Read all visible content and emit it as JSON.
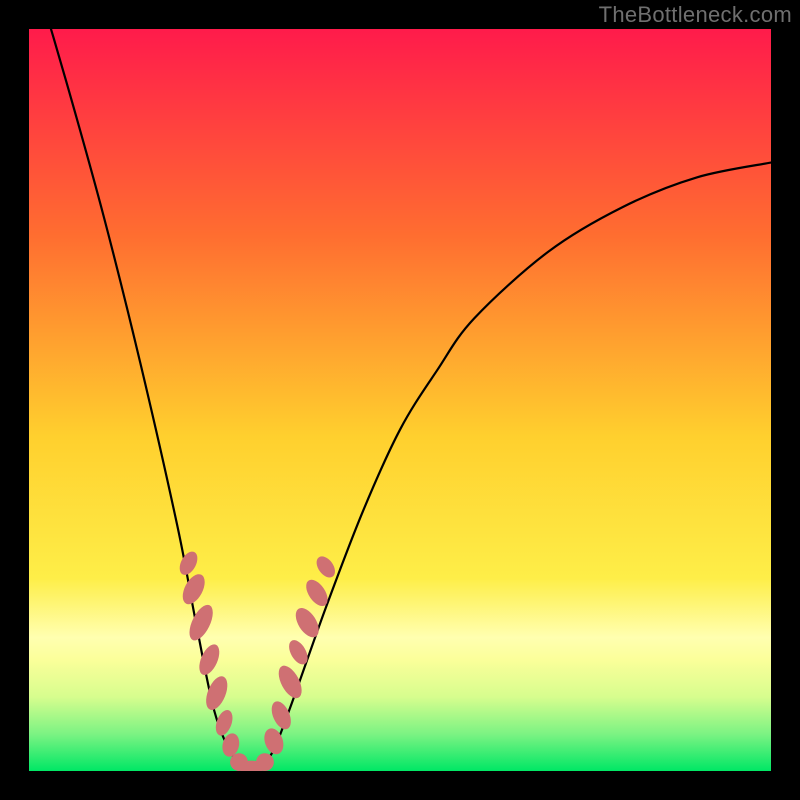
{
  "watermark": "TheBottleneck.com",
  "chart_data": {
    "type": "line",
    "title": "",
    "xlabel": "",
    "ylabel": "",
    "series": [
      {
        "name": "bottleneck-curve",
        "x": [
          0.0,
          0.05,
          0.1,
          0.15,
          0.2,
          0.225,
          0.25,
          0.275,
          0.3,
          0.325,
          0.35,
          0.4,
          0.45,
          0.5,
          0.55,
          0.6,
          0.7,
          0.8,
          0.9,
          1.0
        ],
        "values": [
          1.1,
          0.93,
          0.75,
          0.55,
          0.33,
          0.2,
          0.08,
          0.02,
          0.0,
          0.02,
          0.08,
          0.22,
          0.35,
          0.46,
          0.54,
          0.61,
          0.7,
          0.76,
          0.8,
          0.82
        ]
      }
    ],
    "xlim": [
      0,
      1
    ],
    "ylim": [
      0,
      1
    ],
    "colors": {
      "gradient_top": "#ff1b4b",
      "gradient_mid_hi": "#ff8a28",
      "gradient_mid": "#ffde2e",
      "gradient_pale": "#ffffb0",
      "gradient_bottom": "#00e765",
      "curve_stroke": "#000000",
      "blob_fill": "#cf7073"
    },
    "blobs_left": [
      {
        "cx": 0.215,
        "cy": 0.28,
        "rx": 0.01,
        "ry": 0.017,
        "rot": 28
      },
      {
        "cx": 0.222,
        "cy": 0.245,
        "rx": 0.012,
        "ry": 0.022,
        "rot": 28
      },
      {
        "cx": 0.232,
        "cy": 0.2,
        "rx": 0.012,
        "ry": 0.026,
        "rot": 26
      },
      {
        "cx": 0.243,
        "cy": 0.15,
        "rx": 0.011,
        "ry": 0.022,
        "rot": 24
      },
      {
        "cx": 0.253,
        "cy": 0.105,
        "rx": 0.012,
        "ry": 0.024,
        "rot": 22
      },
      {
        "cx": 0.263,
        "cy": 0.065,
        "rx": 0.01,
        "ry": 0.018,
        "rot": 20
      },
      {
        "cx": 0.272,
        "cy": 0.035,
        "rx": 0.011,
        "ry": 0.016,
        "rot": 14
      },
      {
        "cx": 0.283,
        "cy": 0.012,
        "rx": 0.012,
        "ry": 0.012,
        "rot": 6
      },
      {
        "cx": 0.3,
        "cy": 0.004,
        "rx": 0.016,
        "ry": 0.01,
        "rot": 0
      }
    ],
    "blobs_right": [
      {
        "cx": 0.318,
        "cy": 0.012,
        "rx": 0.012,
        "ry": 0.012,
        "rot": -8
      },
      {
        "cx": 0.33,
        "cy": 0.04,
        "rx": 0.012,
        "ry": 0.018,
        "rot": -20
      },
      {
        "cx": 0.34,
        "cy": 0.075,
        "rx": 0.011,
        "ry": 0.02,
        "rot": -24
      },
      {
        "cx": 0.352,
        "cy": 0.12,
        "rx": 0.012,
        "ry": 0.024,
        "rot": -28
      },
      {
        "cx": 0.363,
        "cy": 0.16,
        "rx": 0.01,
        "ry": 0.018,
        "rot": -30
      },
      {
        "cx": 0.375,
        "cy": 0.2,
        "rx": 0.012,
        "ry": 0.022,
        "rot": -32
      },
      {
        "cx": 0.388,
        "cy": 0.24,
        "rx": 0.011,
        "ry": 0.02,
        "rot": -34
      },
      {
        "cx": 0.4,
        "cy": 0.275,
        "rx": 0.01,
        "ry": 0.016,
        "rot": -36
      }
    ]
  }
}
